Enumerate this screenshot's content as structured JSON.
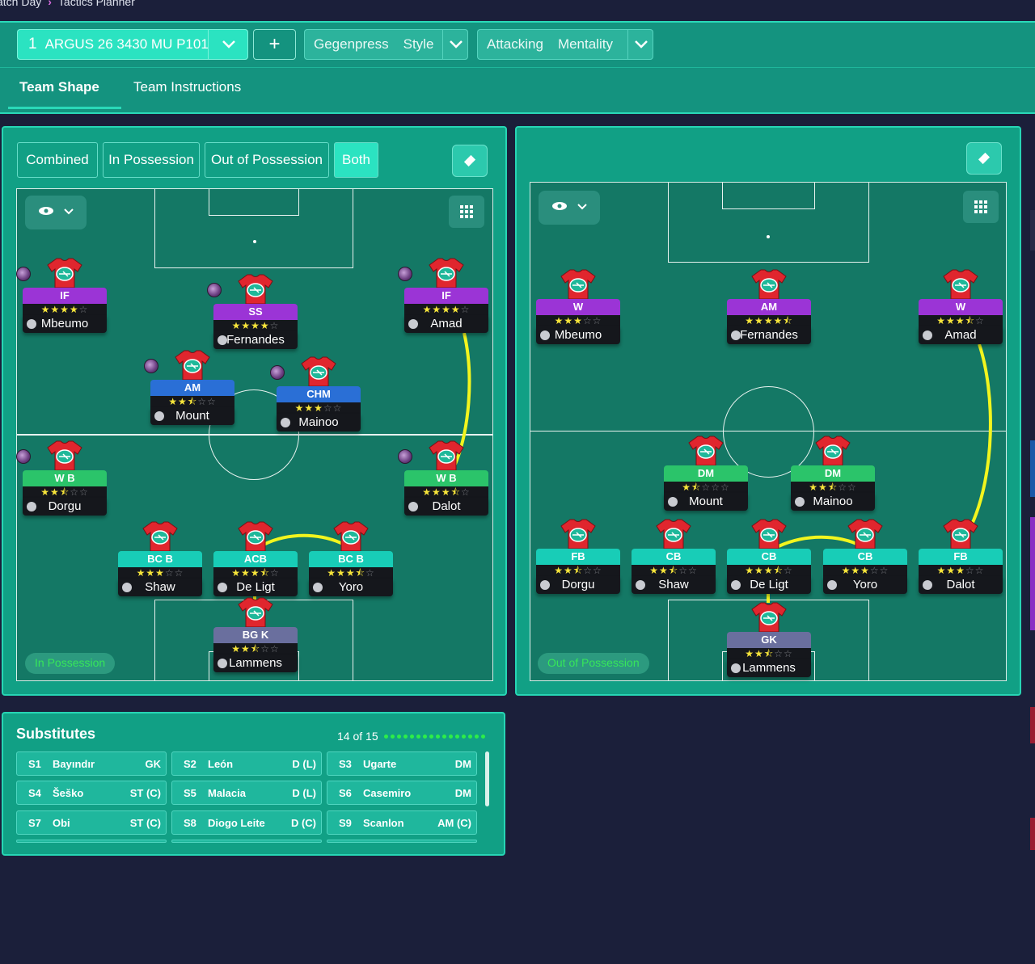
{
  "breadcrumb": {
    "part1": "atch Day",
    "part2": "Tactics Planner"
  },
  "header": {
    "tactic_number": "1",
    "tactic_name": "ARGUS 26 3430 MU P101",
    "add_label": "+",
    "style_value": "Gegenpress",
    "style_label": "Style",
    "mentality_value": "Attacking",
    "mentality_label": "Mentality",
    "tabs": [
      "Team Shape",
      "Team Instructions"
    ]
  },
  "modes": [
    "Combined",
    "In Possession",
    "Out of Possession",
    "Both"
  ],
  "active_mode": "Both",
  "left_pitch": {
    "phase_label": "In Possession",
    "players": [
      {
        "role": "IF",
        "name": "Mbeumo",
        "stars": 4,
        "color": "purple"
      },
      {
        "role": "SS",
        "name": "Fernandes",
        "stars": 4,
        "color": "purple"
      },
      {
        "role": "IF",
        "name": "Amad",
        "stars": 4,
        "color": "purple"
      },
      {
        "role": "AM",
        "name": "Mount",
        "stars": 2.5,
        "color": "blue"
      },
      {
        "role": "CHM",
        "name": "Mainoo",
        "stars": 3,
        "color": "blue"
      },
      {
        "role": "W B",
        "name": "Dorgu",
        "stars": 2.5,
        "color": "green"
      },
      {
        "role": "W B",
        "name": "Dalot",
        "stars": 3.5,
        "color": "green"
      },
      {
        "role": "BC B",
        "name": "Shaw",
        "stars": 3,
        "color": "teal"
      },
      {
        "role": "ACB",
        "name": "De Ligt",
        "stars": 3.5,
        "color": "teal"
      },
      {
        "role": "BC B",
        "name": "Yoro",
        "stars": 3.5,
        "color": "teal"
      },
      {
        "role": "BG K",
        "name": "Lammens",
        "stars": 2.5,
        "color": "slate"
      }
    ]
  },
  "right_pitch": {
    "phase_label": "Out of Possession",
    "players": [
      {
        "role": "W",
        "name": "Mbeumo",
        "stars": 3,
        "color": "purple"
      },
      {
        "role": "AM",
        "name": "Fernandes",
        "stars": 4.5,
        "color": "purple"
      },
      {
        "role": "W",
        "name": "Amad",
        "stars": 3.5,
        "color": "purple"
      },
      {
        "role": "DM",
        "name": "Mount",
        "stars": 1.5,
        "color": "green"
      },
      {
        "role": "DM",
        "name": "Mainoo",
        "stars": 2.5,
        "color": "green"
      },
      {
        "role": "FB",
        "name": "Dorgu",
        "stars": 2.5,
        "color": "teal"
      },
      {
        "role": "CB",
        "name": "Shaw",
        "stars": 2.5,
        "color": "teal"
      },
      {
        "role": "CB",
        "name": "De Ligt",
        "stars": 3.5,
        "color": "teal"
      },
      {
        "role": "CB",
        "name": "Yoro",
        "stars": 3,
        "color": "teal"
      },
      {
        "role": "FB",
        "name": "Dalot",
        "stars": 3,
        "color": "teal"
      },
      {
        "role": "GK",
        "name": "Lammens",
        "stars": 2.5,
        "color": "slate"
      }
    ]
  },
  "substitutes": {
    "title": "Substitutes",
    "count": "14 of 15",
    "items": [
      {
        "slot": "S1",
        "name": "Bayındır",
        "pos": "GK"
      },
      {
        "slot": "S2",
        "name": "León",
        "pos": "D (L)"
      },
      {
        "slot": "S3",
        "name": "Ugarte",
        "pos": "DM"
      },
      {
        "slot": "S4",
        "name": "Šeško",
        "pos": "ST (C)"
      },
      {
        "slot": "S5",
        "name": "Malacia",
        "pos": "D (L)"
      },
      {
        "slot": "S6",
        "name": "Casemiro",
        "pos": "DM"
      },
      {
        "slot": "S7",
        "name": "Obi",
        "pos": "ST (C)"
      },
      {
        "slot": "S8",
        "name": "Diogo Leite",
        "pos": "D (C)"
      },
      {
        "slot": "S9",
        "name": "Scanlon",
        "pos": "AM (C)"
      }
    ]
  },
  "colors": {
    "accent": "#2be3c1",
    "panel": "#11a085",
    "pitch": "#147865",
    "link_line": "#f2f51e",
    "star": "#f7e53a"
  }
}
